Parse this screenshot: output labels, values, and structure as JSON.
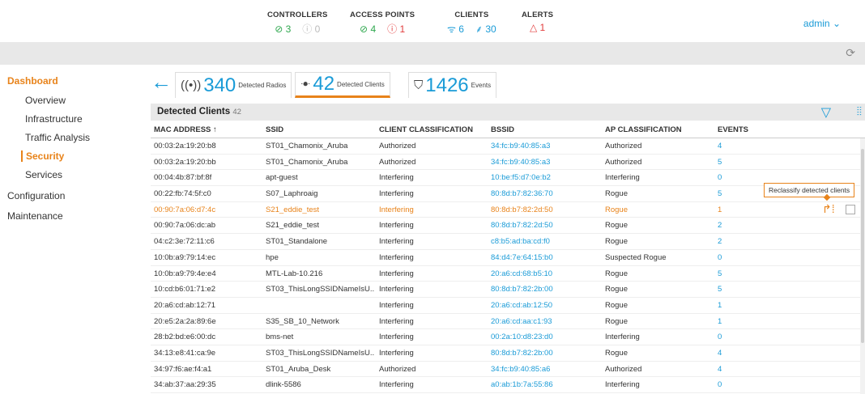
{
  "header": {
    "stats": [
      {
        "label": "CONTROLLERS",
        "values": [
          {
            "icon": "check-circle-icon",
            "glyph": "⊘",
            "value": "3",
            "color": "#2fa84f"
          },
          {
            "icon": "info-circle-icon",
            "glyph": "ⓘ",
            "value": "0",
            "color": "#bbbbbb"
          }
        ]
      },
      {
        "label": "ACCESS POINTS",
        "values": [
          {
            "icon": "check-circle-icon",
            "glyph": "⊘",
            "value": "4",
            "color": "#2fa84f"
          },
          {
            "icon": "alert-circle-icon",
            "glyph": "ⓘ",
            "value": "1",
            "color": "#e23b3b"
          }
        ]
      },
      {
        "label": "CLIENTS",
        "values": [
          {
            "icon": "wifi-icon",
            "glyph": "ᯤ",
            "value": "6",
            "color": "#1a9bd7"
          },
          {
            "icon": "cable-icon",
            "glyph": "⸙",
            "value": "30",
            "color": "#1a9bd7"
          }
        ]
      },
      {
        "label": "ALERTS",
        "values": [
          {
            "icon": "warning-triangle-icon",
            "glyph": "△",
            "value": "1",
            "color": "#e23b3b"
          }
        ]
      }
    ],
    "user": "admin"
  },
  "sidebar": {
    "dashboard": "Dashboard",
    "items": [
      "Overview",
      "Infrastructure",
      "Traffic Analysis",
      "Security",
      "Services"
    ],
    "active": "Security",
    "configuration": "Configuration",
    "maintenance": "Maintenance"
  },
  "tabs": [
    {
      "count": "340",
      "label": "Detected Radios"
    },
    {
      "count": "42",
      "label": "Detected Clients"
    },
    {
      "count": "1426",
      "label": "Events"
    }
  ],
  "table": {
    "title": "Detected Clients",
    "count": "42",
    "columns": [
      "MAC ADDRESS",
      "SSID",
      "CLIENT CLASSIFICATION",
      "BSSID",
      "AP CLASSIFICATION",
      "EVENTS"
    ],
    "rows": [
      [
        "00:03:2a:19:20:b8",
        "ST01_Chamonix_Aruba",
        "Authorized",
        "34:fc:b9:40:85:a3",
        "Authorized",
        "4"
      ],
      [
        "00:03:2a:19:20:bb",
        "ST01_Chamonix_Aruba",
        "Authorized",
        "34:fc:b9:40:85:a3",
        "Authorized",
        "5"
      ],
      [
        "00:04:4b:87:bf:8f",
        "apt-guest",
        "Interfering",
        "10:be:f5:d7:0e:b2",
        "Interfering",
        "0"
      ],
      [
        "00:22:fb:74:5f:c0",
        "S07_Laphroaig",
        "Interfering",
        "80:8d:b7:82:36:70",
        "Rogue",
        "5"
      ],
      [
        "00:90:7a:06:d7:4c",
        "S21_eddie_test",
        "Interfering",
        "80:8d:b7:82:2d:50",
        "Rogue",
        "1"
      ],
      [
        "00:90:7a:06:dc:ab",
        "S21_eddie_test",
        "Interfering",
        "80:8d:b7:82:2d:50",
        "Rogue",
        "2"
      ],
      [
        "04:c2:3e:72:11:c6",
        "ST01_Standalone",
        "Interfering",
        "c8:b5:ad:ba:cd:f0",
        "Rogue",
        "2"
      ],
      [
        "10:0b:a9:79:14:ec",
        "hpe",
        "Interfering",
        "84:d4:7e:64:15:b0",
        "Suspected Rogue",
        "0"
      ],
      [
        "10:0b:a9:79:4e:e4",
        "MTL-Lab-10.216",
        "Interfering",
        "20:a6:cd:68:b5:10",
        "Rogue",
        "5"
      ],
      [
        "10:cd:b6:01:71:e2",
        "ST03_ThisLongSSIDNameIsU...",
        "Interfering",
        "80:8d:b7:82:2b:00",
        "Rogue",
        "5"
      ],
      [
        "20:a6:cd:ab:12:71",
        "",
        "Interfering",
        "20:a6:cd:ab:12:50",
        "Rogue",
        "1"
      ],
      [
        "20:e5:2a:2a:89:6e",
        "S35_SB_10_Network",
        "Interfering",
        "20:a6:cd:aa:c1:93",
        "Rogue",
        "1"
      ],
      [
        "28:b2:bd:e6:00:dc",
        "bms-net",
        "Interfering",
        "00:2a:10:d8:23:d0",
        "Interfering",
        "0"
      ],
      [
        "34:13:e8:41:ca:9e",
        "ST03_ThisLongSSIDNameIsU...",
        "Interfering",
        "80:8d:b7:82:2b:00",
        "Rogue",
        "4"
      ],
      [
        "34:97:f6:ae:f4:a1",
        "ST01_Aruba_Desk",
        "Authorized",
        "34:fc:b9:40:85:a6",
        "Authorized",
        "4"
      ],
      [
        "34:ab:37:aa:29:35",
        "dlink-5586",
        "Interfering",
        "a0:ab:1b:7a:55:86",
        "Interfering",
        "0"
      ]
    ],
    "highlight_row": 4
  },
  "tooltip": "Reclassify detected clients",
  "colors": {
    "accent": "#e8831a",
    "link": "#1a9bd7",
    "ok": "#2fa84f",
    "alert": "#e23b3b"
  }
}
